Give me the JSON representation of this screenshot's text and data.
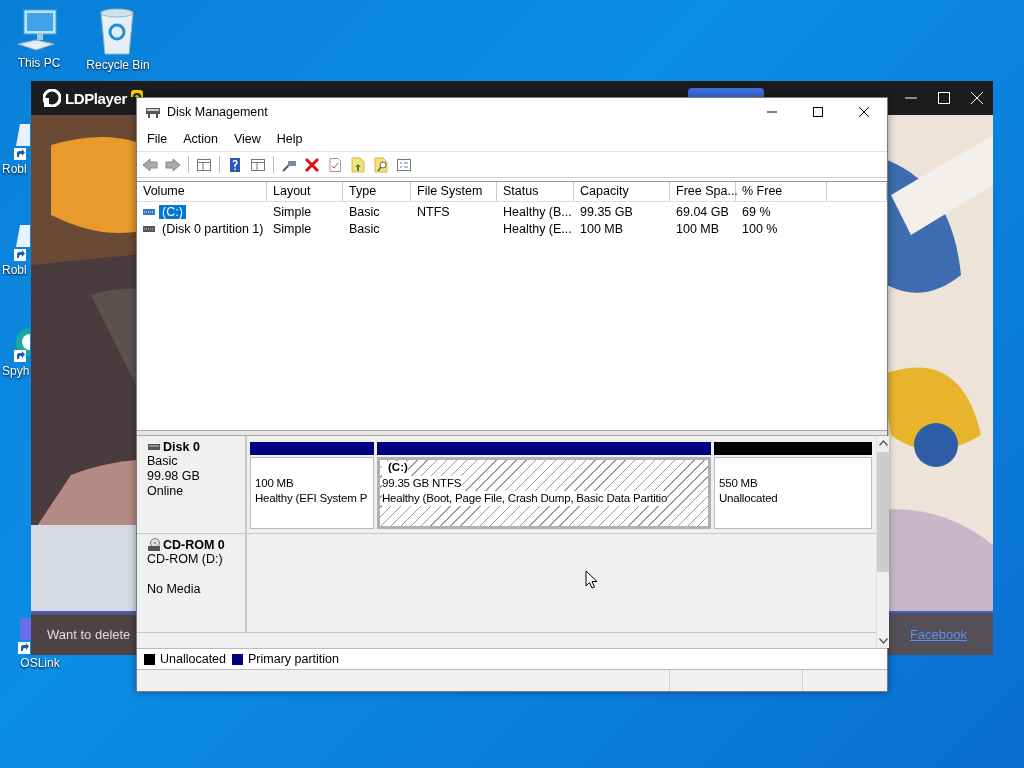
{
  "desktop": {
    "icons": [
      {
        "label": "This PC",
        "kind": "computer"
      },
      {
        "label": "Recycle Bin",
        "kind": "trash"
      },
      {
        "label": "Robl",
        "kind": "tile"
      },
      {
        "label": "Robl",
        "kind": "tile"
      },
      {
        "label": "Spyh",
        "kind": "ring"
      },
      {
        "label": "OSLink",
        "kind": "chip"
      }
    ]
  },
  "ldplayer": {
    "title": "LDPlayer",
    "banner": {
      "text": "Want to delete",
      "link": "Facebook"
    }
  },
  "disk_management": {
    "title": "Disk Management",
    "menu": [
      "File",
      "Action",
      "View",
      "Help"
    ],
    "toolbar": [
      {
        "kind": "back"
      },
      {
        "kind": "forward"
      },
      {
        "kind": "separator"
      },
      {
        "kind": "pane"
      },
      {
        "kind": "separator"
      },
      {
        "kind": "help"
      },
      {
        "kind": "pane"
      },
      {
        "kind": "separator"
      },
      {
        "kind": "connect"
      },
      {
        "kind": "delete"
      },
      {
        "kind": "check"
      },
      {
        "kind": "folder-up"
      },
      {
        "kind": "folder-search"
      },
      {
        "kind": "properties"
      }
    ],
    "volumes": {
      "columns": [
        "Volume",
        "Layout",
        "Type",
        "File System",
        "Status",
        "Capacity",
        "Free Spa...",
        "% Free"
      ],
      "rows": [
        {
          "selected": true,
          "cells": [
            "(C:)",
            "Simple",
            "Basic",
            "NTFS",
            "Healthy (B...",
            "99.35 GB",
            "69.04 GB",
            "69 %"
          ]
        },
        {
          "selected": false,
          "cells": [
            "(Disk 0 partition 1)",
            "Simple",
            "Basic",
            "",
            "Healthy (E...",
            "100 MB",
            "100 MB",
            "100 %"
          ]
        }
      ]
    },
    "disks": [
      {
        "kind": "disk",
        "name": "Disk 0",
        "lines": [
          "Basic",
          "99.98 GB",
          "Online"
        ],
        "partitions": [
          {
            "color": "#000080",
            "selected": false,
            "size": "100 MB",
            "status": "Healthy (EFI System P"
          },
          {
            "color": "#000080",
            "selected": true,
            "name": "(C:)",
            "size": "99.35 GB NTFS",
            "status": "Healthy (Boot, Page File, Crash Dump, Basic Data Partitio"
          },
          {
            "color": "#000000",
            "selected": false,
            "size": "550 MB",
            "status": "Unallocated"
          }
        ]
      },
      {
        "kind": "cdrom",
        "name": "CD-ROM 0",
        "lines": [
          "CD-ROM (D:)",
          "No Media"
        ]
      }
    ],
    "legend": [
      {
        "label": "Unallocated",
        "color": "#000000"
      },
      {
        "label": "Primary partition",
        "color": "#000080"
      }
    ]
  }
}
